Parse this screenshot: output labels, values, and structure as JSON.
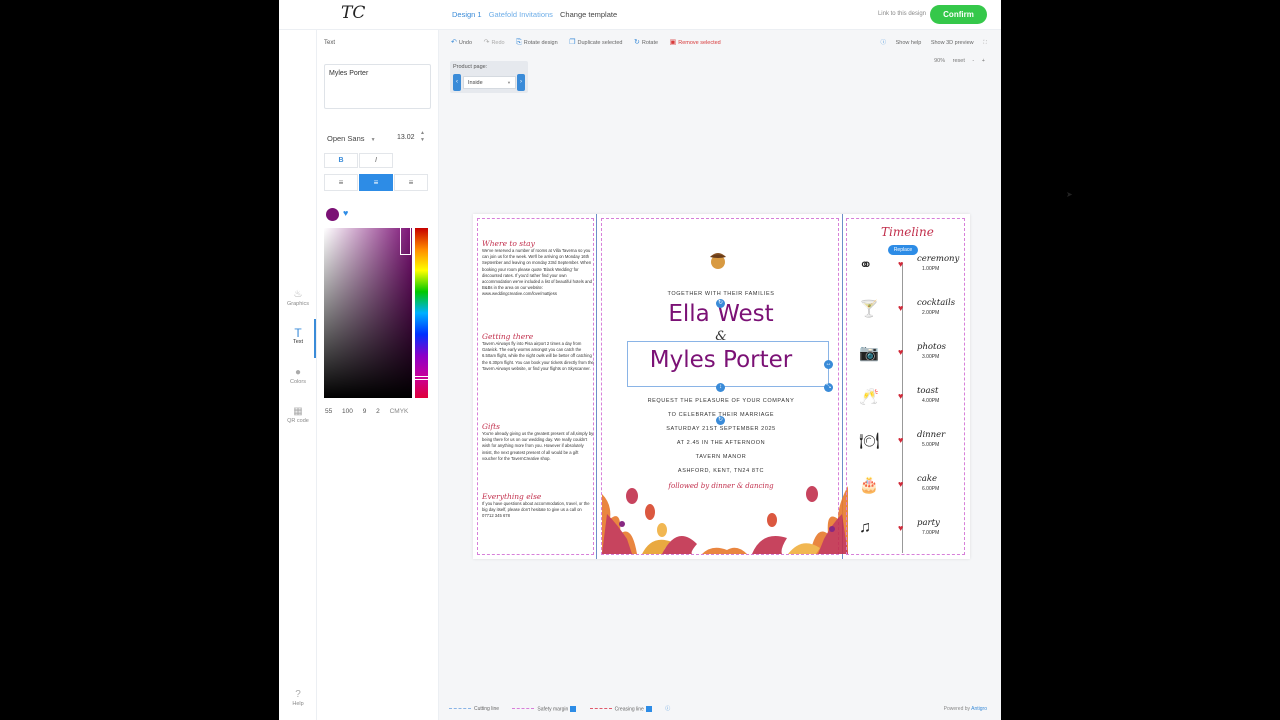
{
  "header": {
    "logo": "TC",
    "crumbs": [
      "Design 1",
      "Gatefold Invitations",
      "Change template"
    ],
    "link_to_design": "Link to this design",
    "confirm": "Confirm"
  },
  "rail": {
    "items": [
      {
        "label": "Graphics",
        "icon": "flame-icon"
      },
      {
        "label": "Text",
        "icon": "text-icon"
      },
      {
        "label": "Colors",
        "icon": "palette-icon"
      },
      {
        "label": "QR code",
        "icon": "qr-icon"
      }
    ],
    "help": "Help"
  },
  "panel": {
    "section": "Text",
    "text_value": "Myles Porter",
    "font": "Open Sans",
    "font_size": "13.02",
    "bold": "B",
    "italic": "I",
    "color": "#7b1175",
    "cmyk": [
      "55",
      "100",
      "9",
      "2",
      "CMYK"
    ]
  },
  "toolbar": {
    "undo": "Undo",
    "redo": "Redo",
    "rotate_design": "Rotate design",
    "duplicate": "Duplicate selected",
    "rotate": "Rotate",
    "remove": "Remove selected",
    "show_help": "Show help",
    "show_3d": "Show 3D preview",
    "zoom": "90%",
    "reset": "reset"
  },
  "product": {
    "label": "Product page:",
    "value": "Inside"
  },
  "invite": {
    "left": [
      {
        "heading": "Where to stay",
        "body": "We've reserved a number of rooms at Villa Taverna so you can join us for the week. We'll be arriving on Monday 16th September and leaving on monday 23rd September. When booking your room please quote 'Black Wedding' for discounted rates. If you'd rather find your own accommodation we've included a list of beautiful hotels and B&Bs in the area on our website: www.weddingcreative.com/love/mattjess"
      },
      {
        "heading": "Getting there",
        "body": "Tavern Airways fly into Pisa airport 2 times a day from Gatwick. The early worms amongst you can catch the 6.50am flight, while the night owls will be better off catching the 6.30pm flight. You can book your tickets directly from the Tavern Airways website, or find your flights on Skyscanner."
      },
      {
        "heading": "Gifts",
        "body": "You're already giving us the greatest present of all,simply by being there for us on our wedding day. We really couldn't wish for anything more from you. However if absolutely insist, the next greatest present of all would be a gift voucher for the TavernCreative shop."
      },
      {
        "heading": "Everything else",
        "body": "If you have questions about accommodation, travel, or the big day itself, please don't hesitate to give us a call on 07712 345 678"
      }
    ],
    "together": "TOGETHER WITH THEIR FAMILIES",
    "name1": "Ella West",
    "amp": "&",
    "name2": "Myles Porter",
    "lines": [
      "REQUEST THE PLEASURE OF YOUR COMPANY",
      "TO CELEBRATE THEIR MARRIAGE",
      "SATURDAY 21ST SEPTEMBER 2025",
      "AT 2.45 IN THE AFTERNOON",
      "TAVERN MANOR",
      "ASHFORD, KENT, TN24 8TC"
    ],
    "followed": "followed by dinner & dancing",
    "timeline_title": "Timeline",
    "replace": "Replace",
    "events": [
      {
        "name": "ceremony",
        "time": "1.00PM",
        "icon": "rings-icon"
      },
      {
        "name": "cocktails",
        "time": "2.00PM",
        "icon": "cocktail-icon"
      },
      {
        "name": "photos",
        "time": "3.00PM",
        "icon": "camera-icon"
      },
      {
        "name": "toast",
        "time": "4.00PM",
        "icon": "champagne-icon"
      },
      {
        "name": "dinner",
        "time": "5.00PM",
        "icon": "plate-icon"
      },
      {
        "name": "cake",
        "time": "6.00PM",
        "icon": "cake-icon"
      },
      {
        "name": "party",
        "time": "7.00PM",
        "icon": "music-icon"
      }
    ]
  },
  "footer": {
    "cutting": "Cutting line",
    "safety": "Safety margin",
    "creasing": "Creasing line",
    "powered": "Powered by",
    "brand": "Antigro"
  }
}
